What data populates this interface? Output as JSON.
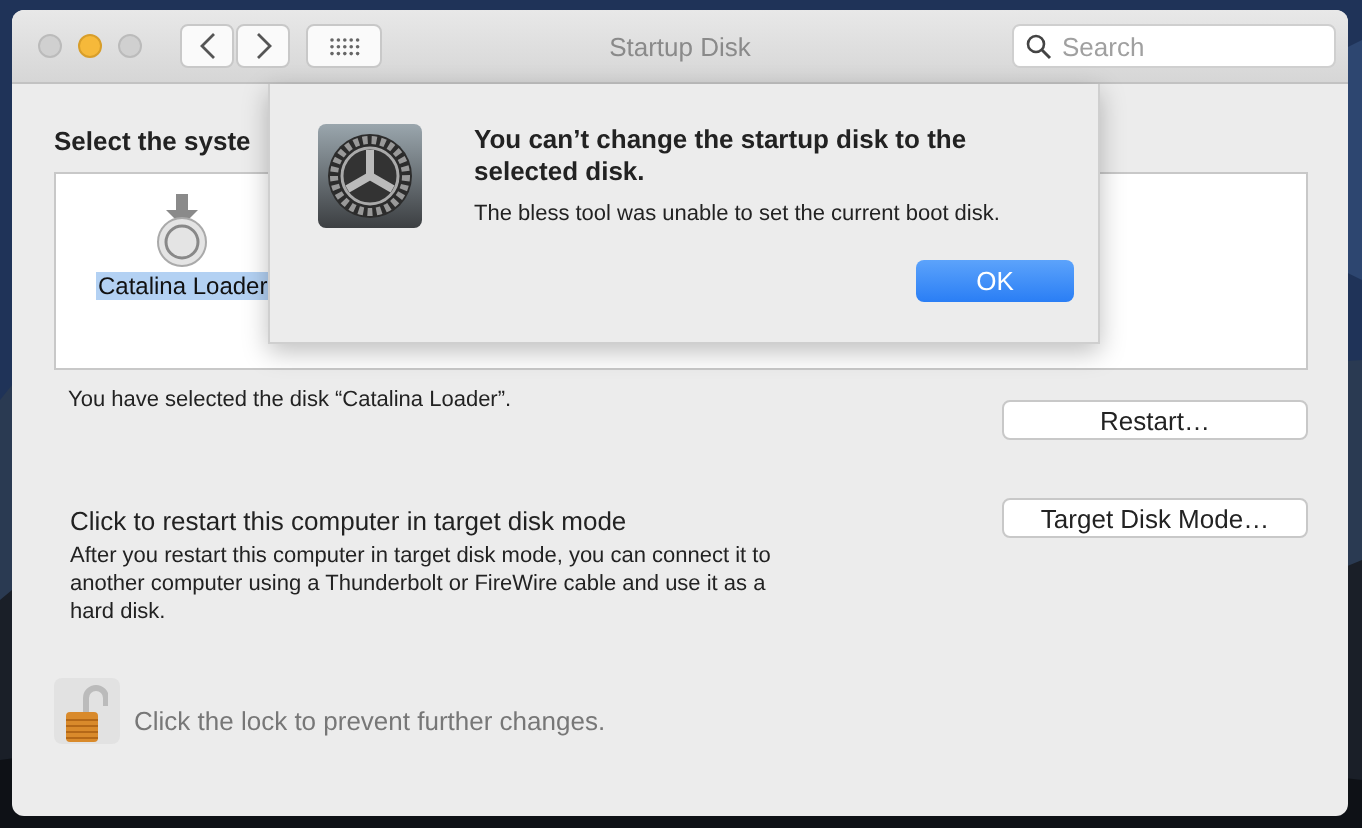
{
  "window": {
    "title": "Startup Disk"
  },
  "toolbar": {
    "search": {
      "placeholder": "Search"
    }
  },
  "main": {
    "heading": "Select the syste",
    "disks": [
      {
        "label": "Catalina Loader",
        "selected": true
      }
    ],
    "selection_text": "You have selected the disk “Catalina Loader”.",
    "restart_button": "Restart…",
    "target_disk": {
      "heading": "Click to restart this computer in target disk mode",
      "description": "After you restart this computer in target disk mode, you can connect it to another computer using a Thunderbolt or FireWire cable and use it as a hard disk.",
      "button": "Target Disk Mode…"
    },
    "lock": {
      "locked": false,
      "text": "Click the lock to prevent further changes."
    }
  },
  "alert": {
    "title": "You can’t change the startup disk to the selected disk.",
    "message": "The bless tool was unable to set the current boot disk.",
    "button": "OK"
  }
}
